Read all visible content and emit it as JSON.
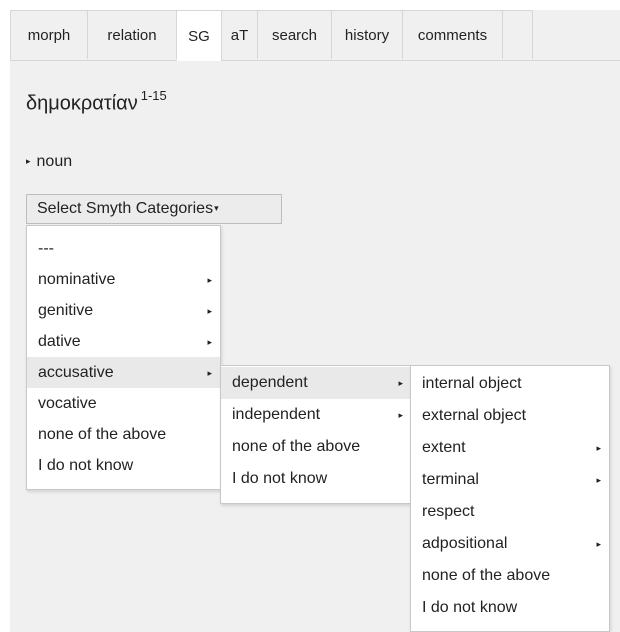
{
  "tabs": [
    {
      "label": "morph"
    },
    {
      "label": "relation"
    },
    {
      "label": "SG"
    },
    {
      "label": "aT"
    },
    {
      "label": "search"
    },
    {
      "label": "history"
    },
    {
      "label": "comments"
    }
  ],
  "lemma": {
    "word": "δημοκρατίαν",
    "range": "1-15"
  },
  "pos": {
    "label": "noun"
  },
  "select_button": {
    "label": "Select Smyth Categories"
  },
  "menu_level1": [
    {
      "label": "---"
    },
    {
      "label": "nominative"
    },
    {
      "label": "genitive"
    },
    {
      "label": "dative"
    },
    {
      "label": "accusative"
    },
    {
      "label": "vocative"
    },
    {
      "label": "none of the above"
    },
    {
      "label": "I do not know"
    }
  ],
  "menu_level2": [
    {
      "label": "dependent"
    },
    {
      "label": "independent"
    },
    {
      "label": "none of the above"
    },
    {
      "label": "I do not know"
    }
  ],
  "menu_level3": [
    {
      "label": "internal object"
    },
    {
      "label": "external object"
    },
    {
      "label": "extent"
    },
    {
      "label": "terminal"
    },
    {
      "label": "respect"
    },
    {
      "label": "adpositional"
    },
    {
      "label": "none of the above"
    },
    {
      "label": "I do not know"
    }
  ],
  "colors": {
    "panel_bg": "#f0f0f0",
    "active_tab": "#ffffff",
    "highlight": "#e9e9e9"
  },
  "icons": {
    "submenu": "triangle-right-icon",
    "caret": "caret-down-icon"
  }
}
